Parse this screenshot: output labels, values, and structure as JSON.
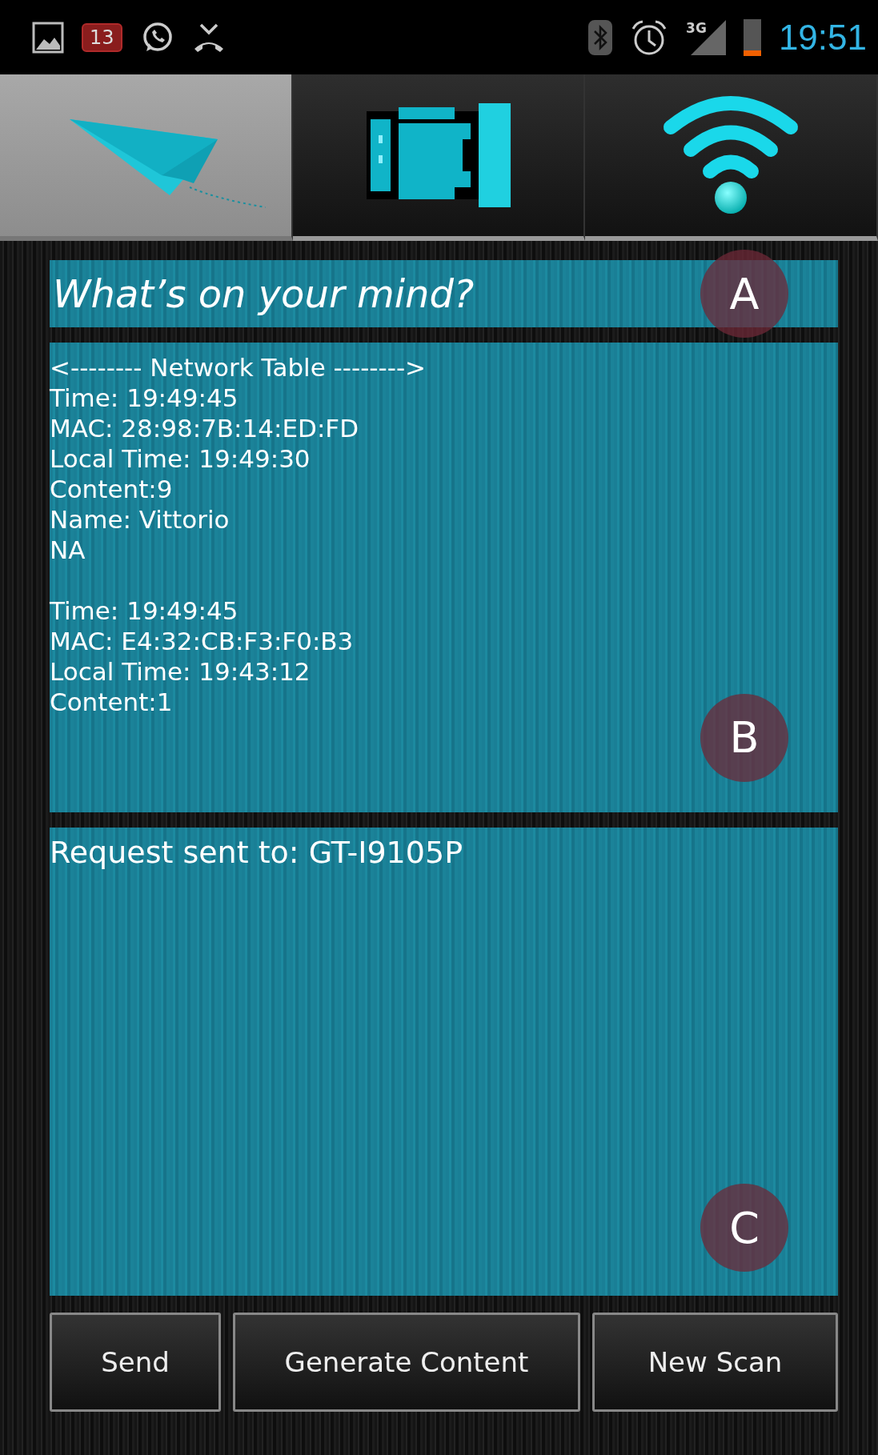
{
  "status_bar": {
    "notification_count": "13",
    "network_type": "3G",
    "time": "19:51"
  },
  "tabs": [
    {
      "kind": "paper-plane",
      "selected": true
    },
    {
      "kind": "device",
      "selected": false
    },
    {
      "kind": "wifi",
      "selected": false
    }
  ],
  "message_field": {
    "placeholder": "What’s on your mind?",
    "marker": "A"
  },
  "network_table": {
    "header": "<-------- Network Table -------->",
    "marker": "B",
    "entries": [
      {
        "lines": [
          "Time: 19:49:45",
          "MAC: 28:98:7B:14:ED:FD",
          "Local Time: 19:49:30",
          "Content:9",
          "Name: Vittorio",
          "NA"
        ]
      },
      {
        "lines": [
          "Time: 19:49:45",
          "MAC: E4:32:CB:F3:F0:B3",
          "Local Time: 19:43:12",
          "Content:1"
        ]
      }
    ]
  },
  "log_panel": {
    "lines": [
      "Request sent to: GT-I9105P"
    ],
    "marker": "C"
  },
  "buttons": [
    "Send",
    "Generate Content",
    "New Scan"
  ]
}
